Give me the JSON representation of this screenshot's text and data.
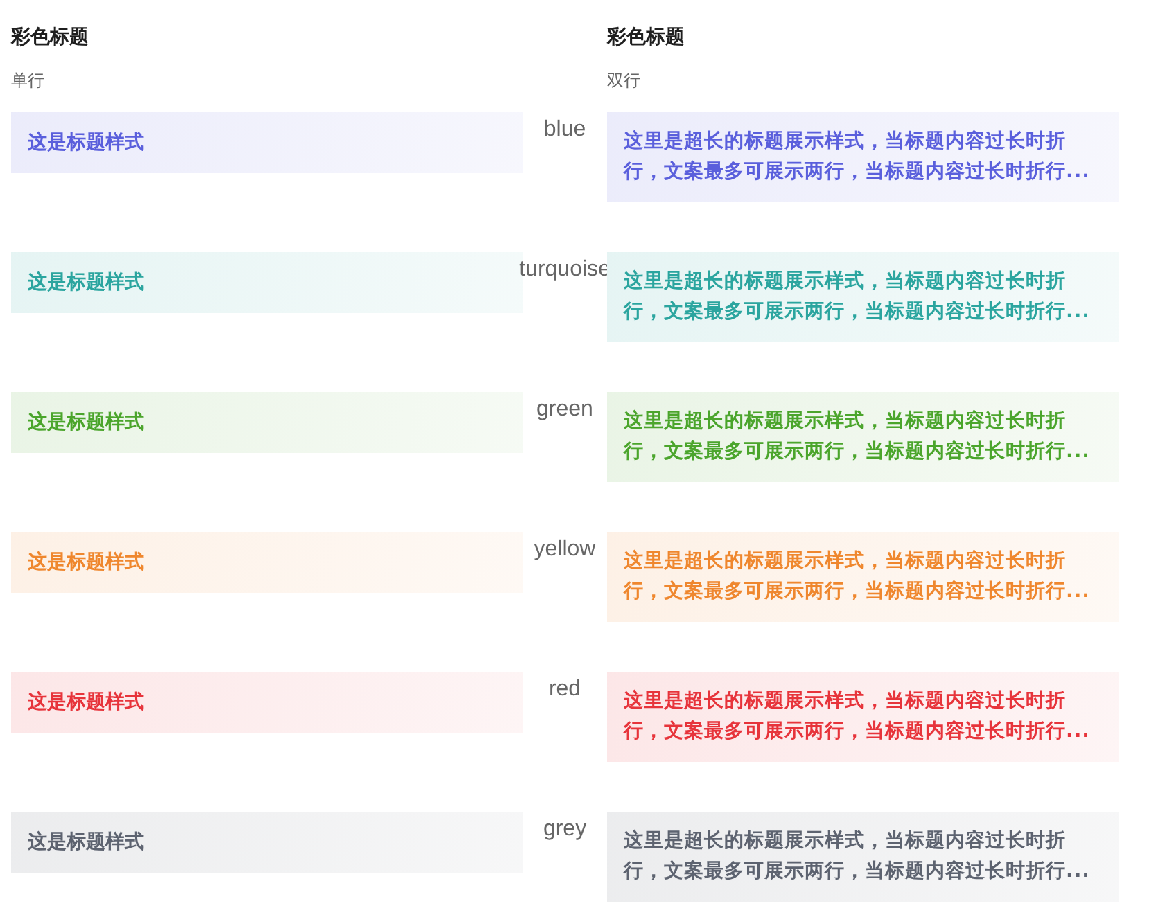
{
  "columns": [
    {
      "title": "彩色标题",
      "subtitle": "单行"
    },
    {
      "title": "彩色标题",
      "subtitle": "双行"
    }
  ],
  "rows": [
    {
      "name": "blue",
      "color": "#5a5fdc",
      "single": "这是标题样式",
      "double": "这里是超长的标题展示样式，当标题内容过长时折行，文案最多可展示两行，当标题内容过长时折行..."
    },
    {
      "name": "turquoise",
      "color": "#2ba59f",
      "single": "这是标题样式",
      "double": "这里是超长的标题展示样式，当标题内容过长时折行，文案最多可展示两行，当标题内容过长时折行..."
    },
    {
      "name": "green",
      "color": "#4ba52c",
      "single": "这是标题样式",
      "double": "这里是超长的标题展示样式，当标题内容过长时折行，文案最多可展示两行，当标题内容过长时折行..."
    },
    {
      "name": "yellow",
      "color": "#ef872e",
      "single": "这是标题样式",
      "double": "这里是超长的标题展示样式，当标题内容过长时折行，文案最多可展示两行，当标题内容过长时折行..."
    },
    {
      "name": "red",
      "color": "#e7343b",
      "single": "这是标题样式",
      "double": "这里是超长的标题展示样式，当标题内容过长时折行，文案最多可展示两行，当标题内容过长时折行..."
    },
    {
      "name": "grey",
      "color": "#5d6370",
      "single": "这是标题样式",
      "double": "这里是超长的标题展示样式，当标题内容过长时折行，文案最多可展示两行，当标题内容过长时折行..."
    }
  ]
}
